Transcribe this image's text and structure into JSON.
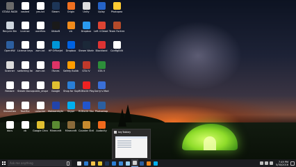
{
  "colors": {
    "taskbar_bg": "#1b1b1f",
    "accent": "#7fb3f0",
    "tent_glow": "#8fdc2a"
  },
  "desktop_icons": [
    {
      "name": "GTA SA RADIO ICON",
      "label": "GTASA RADIO",
      "color": "#6a6a6a"
    },
    {
      "name": "Recycle Bin",
      "label": "Recycle Bin",
      "color": "#cfd6df"
    },
    {
      "name": "Open Hardware Monitor",
      "label": "OpenHW",
      "color": "#2c5fa0"
    },
    {
      "name": "Scanner",
      "label": "Scanner",
      "color": "#ddd"
    },
    {
      "name": "Restore",
      "label": "Restore",
      "color": "#ffffff"
    },
    {
      "name": "Steam Dev",
      "label": "SteamDev",
      "color": "#ffffff"
    },
    {
      "name": "docs",
      "label": "docs",
      "color": "#ffffff"
    },
    {
      "name": "vosked",
      "label": "vosked",
      "color": "#ffffff"
    },
    {
      "name": "License",
      "label": "License",
      "color": "#ffffff"
    },
    {
      "name": "license keys",
      "label": "License keys",
      "color": "#ffffff"
    },
    {
      "name": "switching list",
      "label": "switching list",
      "color": "#ffffff"
    },
    {
      "name": "Steam Document list",
      "label": "Steam Document list",
      "color": "#ffffff"
    },
    {
      "name": "Text file",
      "label": "TextFile",
      "color": "#ffffff"
    },
    {
      "name": "vb",
      "label": "vb",
      "color": "#ffffff"
    },
    {
      "name": "yes.txt",
      "label": "yes.txt",
      "color": "#ffffff"
    },
    {
      "name": "userfiles",
      "label": "userfiles",
      "color": "#ffffff"
    },
    {
      "name": "asm.txt",
      "label": "asm.txt",
      "color": "#ffffff"
    },
    {
      "name": "asm.txt2",
      "label": "asm.txt",
      "color": "#ffffff"
    },
    {
      "name": "public_drupal",
      "label": "public_drupal",
      "color": "#ffffff"
    },
    {
      "name": "unlocker",
      "label": "unlocker",
      "color": "#ffffff"
    },
    {
      "name": "Google Chrome",
      "label": "Google Chrome",
      "color": "#e0c030"
    },
    {
      "name": "Steam",
      "label": "Steam",
      "color": "#1d3557"
    },
    {
      "name": "Ubisoft",
      "label": "Ubisoft",
      "color": "#1a1a1a"
    },
    {
      "name": "HP Officejet",
      "label": "HP Officejet",
      "color": "#0096d6"
    },
    {
      "name": "iTunes",
      "label": "iTunes",
      "color": "#dd3366"
    },
    {
      "name": "Google Chrome 2",
      "label": "Google",
      "color": "#e0c030"
    },
    {
      "name": "Malwarebytes",
      "label": "Malwarebytes",
      "color": "#2244aa"
    },
    {
      "name": "Minecraft",
      "label": "Minecraft",
      "color": "#5a8a32"
    },
    {
      "name": "Origin",
      "label": "Origin",
      "color": "#f07020"
    },
    {
      "name": "vlc",
      "label": "vlc",
      "color": "#f08a1c"
    },
    {
      "name": "Dropbox",
      "label": "Dropbox",
      "color": "#0062e0"
    },
    {
      "name": "Safety Builder",
      "label": "Safety Builder",
      "color": "#ff9c00"
    },
    {
      "name": "Shop for Supplies",
      "label": "Shop for Supplies",
      "color": "#2a7fd6"
    },
    {
      "name": "Skype",
      "label": "Skype",
      "color": "#00aff0"
    },
    {
      "name": "Minecraft 2",
      "label": "Minecraft",
      "color": "#8a6a3a"
    },
    {
      "name": "Unity",
      "label": "Unity",
      "color": "#dedede"
    },
    {
      "name": "Dropbox 2",
      "label": "Dropbox",
      "color": "#2a9af0"
    },
    {
      "name": "Steam Workshop",
      "label": "Steam Workshop",
      "color": "#1b2838"
    },
    {
      "name": "GTA IV",
      "label": "GTA IV",
      "color": "#c0392b"
    },
    {
      "name": "Roblox Player",
      "label": "ROBLOX Player",
      "color": "#e22"
    },
    {
      "name": "Roblox Studio",
      "label": "ROBLOX Studio",
      "color": "#2255cc"
    },
    {
      "name": "Counter Strike",
      "label": "Counter Strike",
      "color": "#c68a2e"
    },
    {
      "name": "Uplay",
      "label": "Uplay",
      "color": "#2563c7"
    },
    {
      "name": "Left 4 Dead 2",
      "label": "Left 4 Dead 2",
      "color": "#d43"
    },
    {
      "name": "Blockland",
      "label": "Blockland",
      "color": "#d33"
    },
    {
      "name": "GTA V",
      "label": "GTA V",
      "color": "#2d8e3a"
    },
    {
      "name": "Garry's Mod",
      "label": "Garry's Mod",
      "color": "#3a6fd6"
    },
    {
      "name": "Photoshop",
      "label": "Photoshop",
      "color": "#2c5fa0"
    },
    {
      "name": "Audacity",
      "label": "Audacity",
      "color": "#f06a1c"
    },
    {
      "name": "Photopea",
      "label": "Photopea",
      "color": "#ffcc33"
    },
    {
      "name": "Team Fortress 2",
      "label": "Team Fortress 2",
      "color": "#b44a2a"
    },
    {
      "name": "ConfigEdit",
      "label": "ConfigEdit",
      "color": "#ffffff"
    }
  ],
  "thumbnail": {
    "title": "keyTabkey"
  },
  "taskbar": {
    "search_placeholder": "Ask me anything",
    "clock_time": "7:49 PM",
    "clock_date": "5/30/2016",
    "apps": [
      {
        "name": "task-view",
        "color": "#e6e6e6"
      },
      {
        "name": "edge",
        "color": "#2b7cd3"
      },
      {
        "name": "file-explorer",
        "color": "#f2c24a"
      },
      {
        "name": "chrome",
        "color": "#e0c030"
      },
      {
        "name": "steam",
        "color": "#1d3557"
      },
      {
        "name": "store",
        "color": "#2b7cd3"
      },
      {
        "name": "mail",
        "color": "#3c8ad8"
      },
      {
        "name": "notepad",
        "color": "#9ad0f0"
      },
      {
        "name": "settings",
        "color": "#cfcfcf"
      },
      {
        "name": "photoshop",
        "color": "#2c5fa0"
      },
      {
        "name": "vlc",
        "color": "#f08a1c"
      },
      {
        "name": "skype",
        "color": "#00aff0"
      }
    ]
  }
}
